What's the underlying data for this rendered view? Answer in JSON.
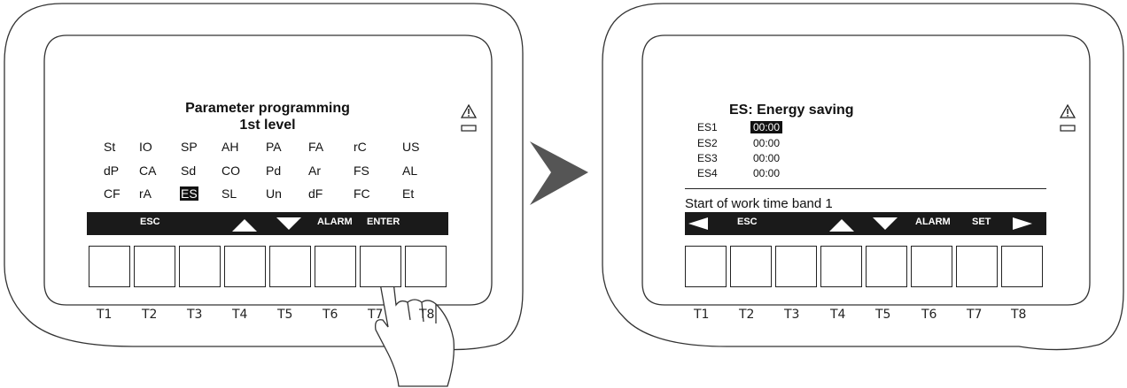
{
  "left_panel": {
    "title_line1": "Parameter programming",
    "title_line2": "1st level",
    "parameters": [
      [
        "St",
        "IO",
        "SP",
        "AH",
        "PA",
        "FA",
        "rC",
        "US"
      ],
      [
        "dP",
        "CA",
        "Sd",
        "CO",
        "Pd",
        "Ar",
        "FS",
        "AL"
      ],
      [
        "CF",
        "rA",
        "ES",
        "SL",
        "Un",
        "dF",
        "FC",
        "Et"
      ]
    ],
    "selected_parameter": "ES",
    "softkeys": {
      "esc": "ESC",
      "alarm": "ALARM",
      "enter": "ENTER"
    },
    "key_labels": [
      "T1",
      "T2",
      "T3",
      "T4",
      "T5",
      "T6",
      "T7",
      "T8"
    ],
    "pressed_key": "T7"
  },
  "right_panel": {
    "title": "ES: Energy saving",
    "rows": [
      {
        "name": "ES1",
        "value": "00:00",
        "selected": true
      },
      {
        "name": "ES2",
        "value": "00:00",
        "selected": false
      },
      {
        "name": "ES3",
        "value": "00:00",
        "selected": false
      },
      {
        "name": "ES4",
        "value": "00:00",
        "selected": false
      }
    ],
    "description": "Start of work time band 1",
    "softkeys": {
      "esc": "ESC",
      "alarm": "ALARM",
      "set": "SET"
    },
    "key_labels": [
      "T1",
      "T2",
      "T3",
      "T4",
      "T5",
      "T6",
      "T7",
      "T8"
    ]
  },
  "icons": [
    "warning-triangle-icon",
    "hand-pointer-icon",
    "arrow-right-icon",
    "arrow-up-icon",
    "arrow-down-icon",
    "arrow-left-icon"
  ],
  "colors": {
    "outline": "#333333",
    "screen_bar": "#1a1a1a",
    "transition_arrow": "#555555"
  }
}
